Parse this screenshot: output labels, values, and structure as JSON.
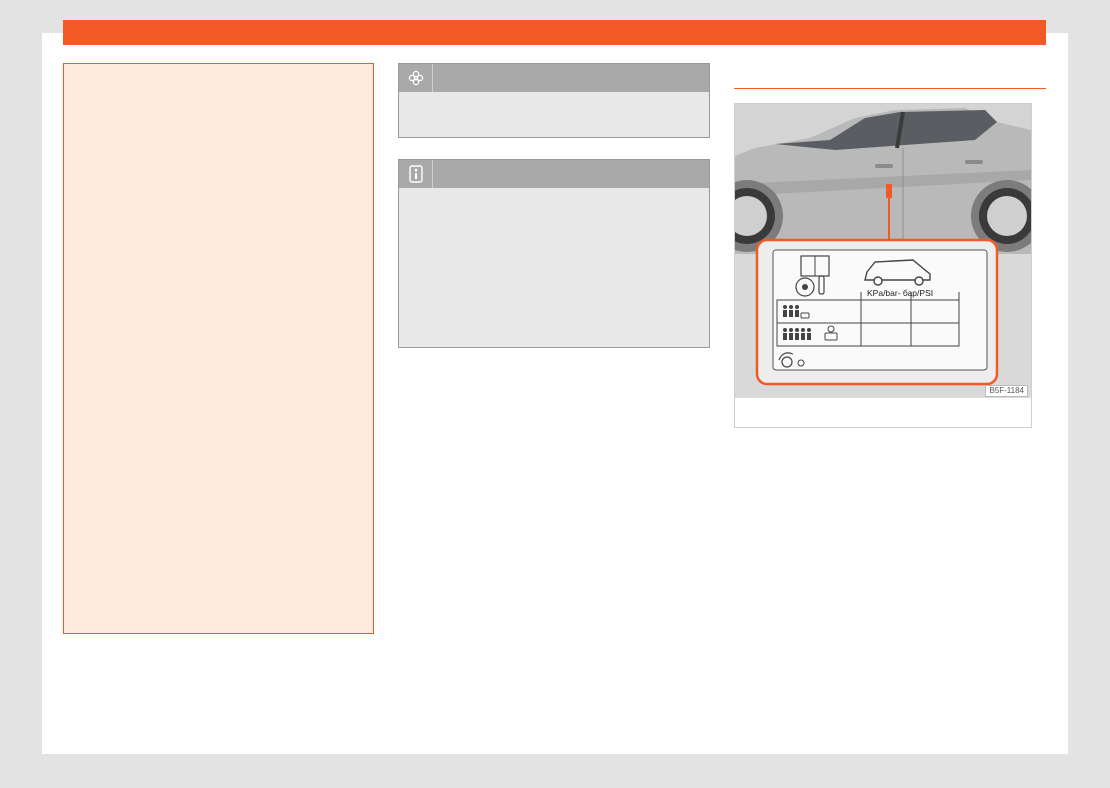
{
  "figure": {
    "code": "B5F-1184",
    "label_units": "KPa/bar- бар/PSI"
  },
  "colors": {
    "accent": "#f15a24",
    "warning_bg": "#fdeadd",
    "note_bg": "#e8e8e8",
    "note_header": "#a9a9a9"
  },
  "icons": {
    "environment": "flower-icon",
    "information": "info-icon"
  }
}
